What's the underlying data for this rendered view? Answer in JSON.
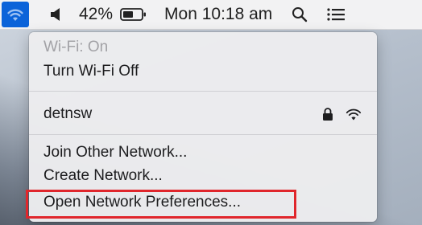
{
  "menubar": {
    "battery_percent": "42%",
    "clock": "Mon 10:18 am",
    "icons": [
      "wifi-icon",
      "volume-icon",
      "battery-icon",
      "search-icon",
      "list-icon"
    ]
  },
  "menu": {
    "wifi_status": "Wi-Fi: On",
    "toggle_label": "Turn Wi-Fi Off",
    "network_name": "detnsw",
    "network_icons": [
      "lock-icon",
      "wifi-signal-icon"
    ],
    "join_other": "Join Other Network...",
    "create_network": "Create Network...",
    "open_prefs": "Open Network Preferences..."
  },
  "colors": {
    "highlight": "#e0262c",
    "accent": "#0b63d9"
  }
}
